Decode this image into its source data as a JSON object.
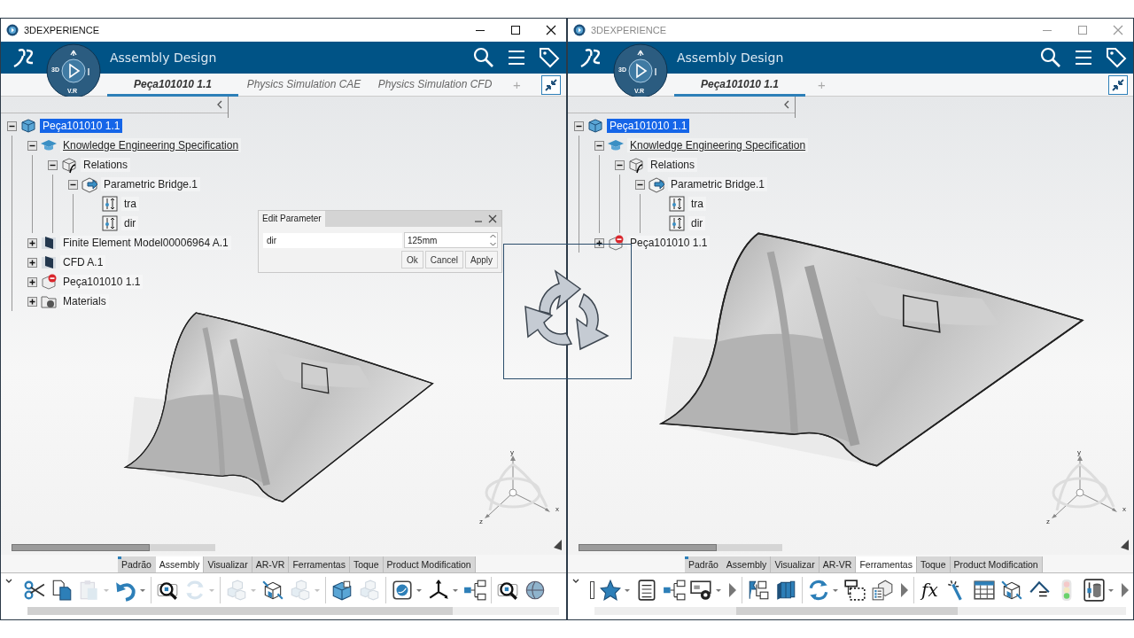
{
  "windows": [
    {
      "active": true,
      "title": "3DEXPERIENCE",
      "app_title": "Assembly Design",
      "compass_labels": [
        "3D",
        "V.R"
      ],
      "tabs": [
        {
          "label": "Peça101010 1.1",
          "selected": true
        },
        {
          "label": "Physics Simulation CAE",
          "selected": false
        },
        {
          "label": "Physics Simulation CFD",
          "selected": false
        }
      ],
      "add_tab_label": "+",
      "tree": [
        {
          "label": "Peça101010 1.1",
          "kind": "product",
          "expanded": true,
          "selected": true,
          "underlined": false,
          "children": [
            {
              "label": "Knowledge Engineering Specification",
              "kind": "knowledge",
              "expanded": true,
              "selected": false,
              "underlined": true,
              "children": [
                {
                  "label": "Relations",
                  "kind": "relations",
                  "expanded": true,
                  "selected": false,
                  "underlined": false,
                  "children": [
                    {
                      "label": "Parametric Bridge.1",
                      "kind": "bridge",
                      "expanded": true,
                      "selected": false,
                      "underlined": false,
                      "children": [
                        {
                          "label": "tra",
                          "kind": "parameter",
                          "selected": false,
                          "underlined": false
                        },
                        {
                          "label": "dir",
                          "kind": "parameter",
                          "selected": false,
                          "underlined": false
                        }
                      ]
                    }
                  ]
                }
              ]
            },
            {
              "label": "Finite Element Model00006964 A.1",
              "kind": "mesh",
              "expanded": false,
              "selected": false,
              "underlined": false
            },
            {
              "label": "CFD A.1",
              "kind": "mesh",
              "expanded": false,
              "selected": false,
              "underlined": false
            },
            {
              "label": "Peça101010 1.1",
              "kind": "blocked",
              "expanded": false,
              "selected": false,
              "underlined": false
            },
            {
              "label": "Materials",
              "kind": "materials",
              "expanded": false,
              "selected": false,
              "underlined": false
            }
          ]
        }
      ],
      "dialog": {
        "title": "Edit Parameter",
        "name": "dir",
        "value": "125mm",
        "buttons": [
          "Ok",
          "Cancel",
          "Apply"
        ]
      },
      "model": {
        "kind": "picture"
      },
      "axes": [
        "y",
        "x",
        "z"
      ],
      "workbench_tabs": [
        {
          "label": "Padrão",
          "selected": false
        },
        {
          "label": "Assembly",
          "selected": true
        },
        {
          "label": "Visualizar",
          "selected": false
        },
        {
          "label": "AR-VR",
          "selected": false
        },
        {
          "label": "Ferramentas",
          "selected": false
        },
        {
          "label": "Toque",
          "selected": false
        },
        {
          "label": "Product Modification",
          "selected": false
        }
      ],
      "toolbar": [
        {
          "kind": "scissors",
          "disabled": false,
          "dropdown": false
        },
        {
          "kind": "copy",
          "disabled": false,
          "dropdown": false
        },
        {
          "kind": "paste",
          "disabled": true,
          "dropdown": true
        },
        {
          "kind": "undo",
          "disabled": false,
          "dropdown": true
        },
        {
          "kind": "separator"
        },
        {
          "kind": "zoom",
          "disabled": false,
          "dropdown": false
        },
        {
          "kind": "rotate",
          "disabled": true,
          "dropdown": true
        },
        {
          "kind": "separator"
        },
        {
          "kind": "cubes",
          "disabled": true,
          "dropdown": true
        },
        {
          "kind": "cube-move",
          "disabled": false,
          "dropdown": false
        },
        {
          "kind": "cubes",
          "disabled": true,
          "dropdown": true
        },
        {
          "kind": "separator"
        },
        {
          "kind": "cube",
          "disabled": false,
          "dropdown": false
        },
        {
          "kind": "cubes",
          "disabled": true,
          "dropdown": false
        },
        {
          "kind": "separator"
        },
        {
          "kind": "disc",
          "disabled": false,
          "dropdown": true
        },
        {
          "kind": "axes",
          "disabled": false,
          "dropdown": true
        },
        {
          "kind": "tree",
          "disabled": false,
          "dropdown": false
        },
        {
          "kind": "separator"
        },
        {
          "kind": "zoom",
          "disabled": false,
          "dropdown": false
        },
        {
          "kind": "globe",
          "disabled": false,
          "dropdown": false
        }
      ]
    },
    {
      "active": false,
      "title": "3DEXPERIENCE",
      "app_title": "Assembly Design",
      "compass_labels": [
        "3D",
        "V.R"
      ],
      "tabs": [
        {
          "label": "Peça101010 1.1",
          "selected": true
        }
      ],
      "add_tab_label": "+",
      "tree": [
        {
          "label": "Peça101010 1.1",
          "kind": "product",
          "expanded": true,
          "selected": true,
          "underlined": false,
          "children": [
            {
              "label": "Knowledge Engineering Specification",
              "kind": "knowledge",
              "expanded": true,
              "selected": false,
              "underlined": true,
              "children": [
                {
                  "label": "Relations",
                  "kind": "relations",
                  "expanded": true,
                  "selected": false,
                  "underlined": false,
                  "children": [
                    {
                      "label": "Parametric Bridge.1",
                      "kind": "bridge",
                      "expanded": true,
                      "selected": false,
                      "underlined": false,
                      "children": [
                        {
                          "label": "tra",
                          "kind": "parameter",
                          "selected": false,
                          "underlined": false
                        },
                        {
                          "label": "dir",
                          "kind": "parameter",
                          "selected": false,
                          "underlined": false
                        }
                      ]
                    }
                  ]
                }
              ]
            },
            {
              "label": "Peça101010 1.1",
              "kind": "blocked",
              "expanded": false,
              "selected": false,
              "underlined": false
            }
          ]
        }
      ],
      "model": {
        "kind": "picture"
      },
      "axes": [
        "y",
        "x",
        "z"
      ],
      "workbench_tabs": [
        {
          "label": "Padrão",
          "selected": false
        },
        {
          "label": "Assembly",
          "selected": false
        },
        {
          "label": "Visualizar",
          "selected": false
        },
        {
          "label": "AR-VR",
          "selected": false
        },
        {
          "label": "Ferramentas",
          "selected": true
        },
        {
          "label": "Toque",
          "selected": false
        },
        {
          "label": "Product Modification",
          "selected": false
        }
      ],
      "toolbar": [
        {
          "kind": "star",
          "disabled": false,
          "dropdown": true
        },
        {
          "kind": "notes",
          "disabled": false,
          "dropdown": false
        },
        {
          "kind": "tree",
          "disabled": false,
          "dropdown": false
        },
        {
          "kind": "panel-gear",
          "disabled": false,
          "dropdown": true
        },
        {
          "kind": "more"
        },
        {
          "kind": "separator"
        },
        {
          "kind": "flags",
          "disabled": false,
          "dropdown": false
        },
        {
          "kind": "books",
          "disabled": false,
          "dropdown": false
        },
        {
          "kind": "separator"
        },
        {
          "kind": "refresh",
          "disabled": false,
          "dropdown": true
        },
        {
          "kind": "dashed-box",
          "disabled": false,
          "dropdown": false
        },
        {
          "kind": "cube-list",
          "disabled": false,
          "dropdown": false
        },
        {
          "kind": "more"
        },
        {
          "kind": "separator"
        },
        {
          "kind": "formula",
          "label": "fx",
          "disabled": false,
          "dropdown": false
        },
        {
          "kind": "wand",
          "disabled": false,
          "dropdown": false
        },
        {
          "kind": "table",
          "disabled": false,
          "dropdown": false
        },
        {
          "kind": "cube-move",
          "disabled": false,
          "dropdown": false
        },
        {
          "kind": "angle",
          "disabled": false,
          "dropdown": false
        },
        {
          "kind": "traffic-light",
          "disabled": false,
          "dropdown": false
        },
        {
          "kind": "slider",
          "disabled": false,
          "dropdown": true
        },
        {
          "kind": "more"
        }
      ]
    }
  ]
}
